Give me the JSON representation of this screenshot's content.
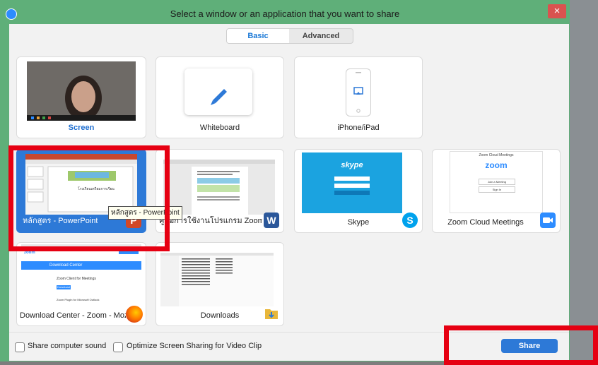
{
  "window": {
    "title": "Select a window or an application that you want to share",
    "close_glyph": "×"
  },
  "tabs": [
    {
      "label": "Basic",
      "active": true
    },
    {
      "label": "Advanced",
      "active": false
    }
  ],
  "cards": [
    {
      "label": "Screen",
      "kind": "screen"
    },
    {
      "label": "Whiteboard",
      "kind": "whiteboard"
    },
    {
      "label": "iPhone/iPad",
      "kind": "iphone"
    },
    {
      "label": "หลักสูตร - PowerPoint",
      "kind": "powerpoint",
      "selected": true
    },
    {
      "label": "คู่มือการใช้งานโปรแกรม Zoom สำหรับ...",
      "kind": "word"
    },
    {
      "label": "Skype",
      "kind": "skype"
    },
    {
      "label": "Zoom Cloud Meetings",
      "kind": "zoom"
    },
    {
      "label": "Download Center - Zoom - Mozil...",
      "kind": "firefox"
    },
    {
      "label": "Downloads",
      "kind": "folder"
    }
  ],
  "tooltip": "หลักสูตร - PowerPoint",
  "thumbnails": {
    "ppt_slide_title": "โรงเรียนเตรียมการเรียน",
    "skype_brand": "skype",
    "zoom_brand": "zoom",
    "zoom_window_title": "Zoom Cloud Meetings",
    "zoom_join": "Join a Meeting",
    "zoom_signin": "Sign In",
    "zoom_web_logo": "zoom",
    "zoom_web_heading": "Download Center",
    "zoom_web_sub1": "Zoom Client for Meetings",
    "zoom_web_btn": "Download",
    "zoom_web_sub2": "Zoom Plugin for Microsoft Outlook",
    "ppt_badge": "P",
    "word_badge": "W"
  },
  "bottom": {
    "share_sound": "Share computer sound",
    "optimize": "Optimize Screen Sharing for Video Clip",
    "share_button": "Share"
  },
  "colors": {
    "accent": "#2d79d7",
    "highlight": "#e60012",
    "window_frame": "#5faf79"
  }
}
